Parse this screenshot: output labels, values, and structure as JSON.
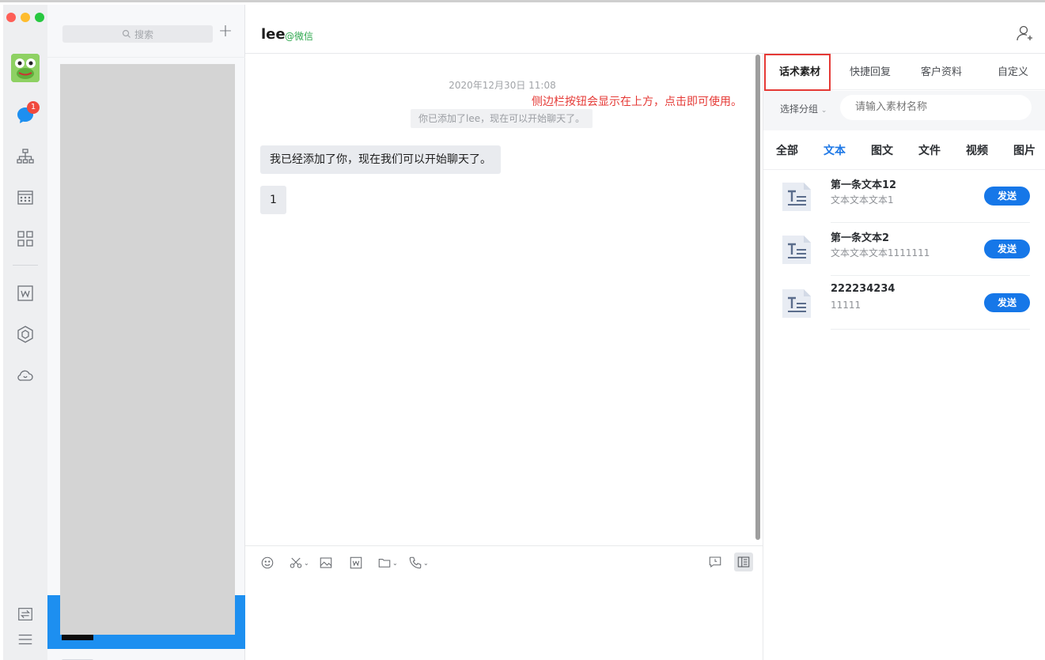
{
  "sidebar_rail": {
    "badge_count": "1",
    "icons": [
      "message-icon",
      "org-chart-icon",
      "calendar-icon",
      "apps-grid-icon",
      "doc-icon",
      "box-icon",
      "cloud-icon",
      "transfer-icon",
      "menu-icon"
    ]
  },
  "contacts": {
    "search_placeholder": "搜索"
  },
  "chat": {
    "name": "lee",
    "source": "@微信",
    "timestamp": "2020年12月30日 11:08",
    "system_message": "你已添加了lee，现在可以开始聊天了。",
    "annotation": "侧边栏按钮会显示在上方，点击即可使用。",
    "messages": [
      {
        "text": "我已经添加了你，现在我们可以开始聊天了。"
      },
      {
        "text": "1"
      }
    ]
  },
  "side_panel": {
    "tabs": [
      {
        "label": "话术素材",
        "active": true
      },
      {
        "label": "快捷回复",
        "active": false
      },
      {
        "label": "客户资料",
        "active": false
      },
      {
        "label": "自定义",
        "active": false
      }
    ],
    "group_select": "选择分组",
    "material_search_placeholder": "请输入素材名称",
    "categories": [
      {
        "label": "全部",
        "active": false
      },
      {
        "label": "文本",
        "active": true
      },
      {
        "label": "图文",
        "active": false
      },
      {
        "label": "文件",
        "active": false
      },
      {
        "label": "视频",
        "active": false
      },
      {
        "label": "图片",
        "active": false
      }
    ],
    "items": [
      {
        "title": "第一条文本12",
        "subtitle": "文本文本文本1",
        "action": "发送"
      },
      {
        "title": "第一条文本2",
        "subtitle": "文本文本文本1111111",
        "action": "发送"
      },
      {
        "title": "222234234",
        "subtitle": "11111",
        "action": "发送"
      }
    ]
  },
  "colors": {
    "accent": "#1677e8",
    "annotation": "#e53935",
    "selected_row": "#1d8ff0",
    "badge": "#f04a3e",
    "source_tag": "#2fa84f"
  }
}
